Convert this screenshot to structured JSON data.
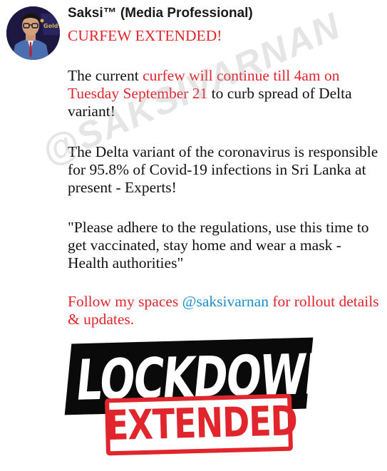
{
  "author": {
    "name": "Saksi™ (Media Professional)",
    "avatar_icon": "profile-photo"
  },
  "post": {
    "headline": "CURFEW EXTENDED!",
    "para1": {
      "part1": "The current ",
      "part2": "curfew will continue till 4am on Tuesday  September 21",
      "part3": " to curb spread of Delta variant!"
    },
    "para2": "The Delta variant of the coronavirus is responsible for 95.8% of Covid-19 infections in Sri Lanka at present - Experts!",
    "para3": "\"Please adhere to the regulations, use this time to get vaccinated, stay home and wear a mask - Health authorities\"",
    "para4": {
      "part1": "Follow my spaces ",
      "handle": "@saksivarnan",
      "part2": " for rollout details & updates."
    }
  },
  "watermark": "@SAKSIVARNAN",
  "graphic": {
    "line1": "LOCKDOWN",
    "line2": "EXTENDED"
  },
  "colors": {
    "accent_red": "#e0262c",
    "link_blue": "#1a8fd0",
    "text": "#111111"
  }
}
